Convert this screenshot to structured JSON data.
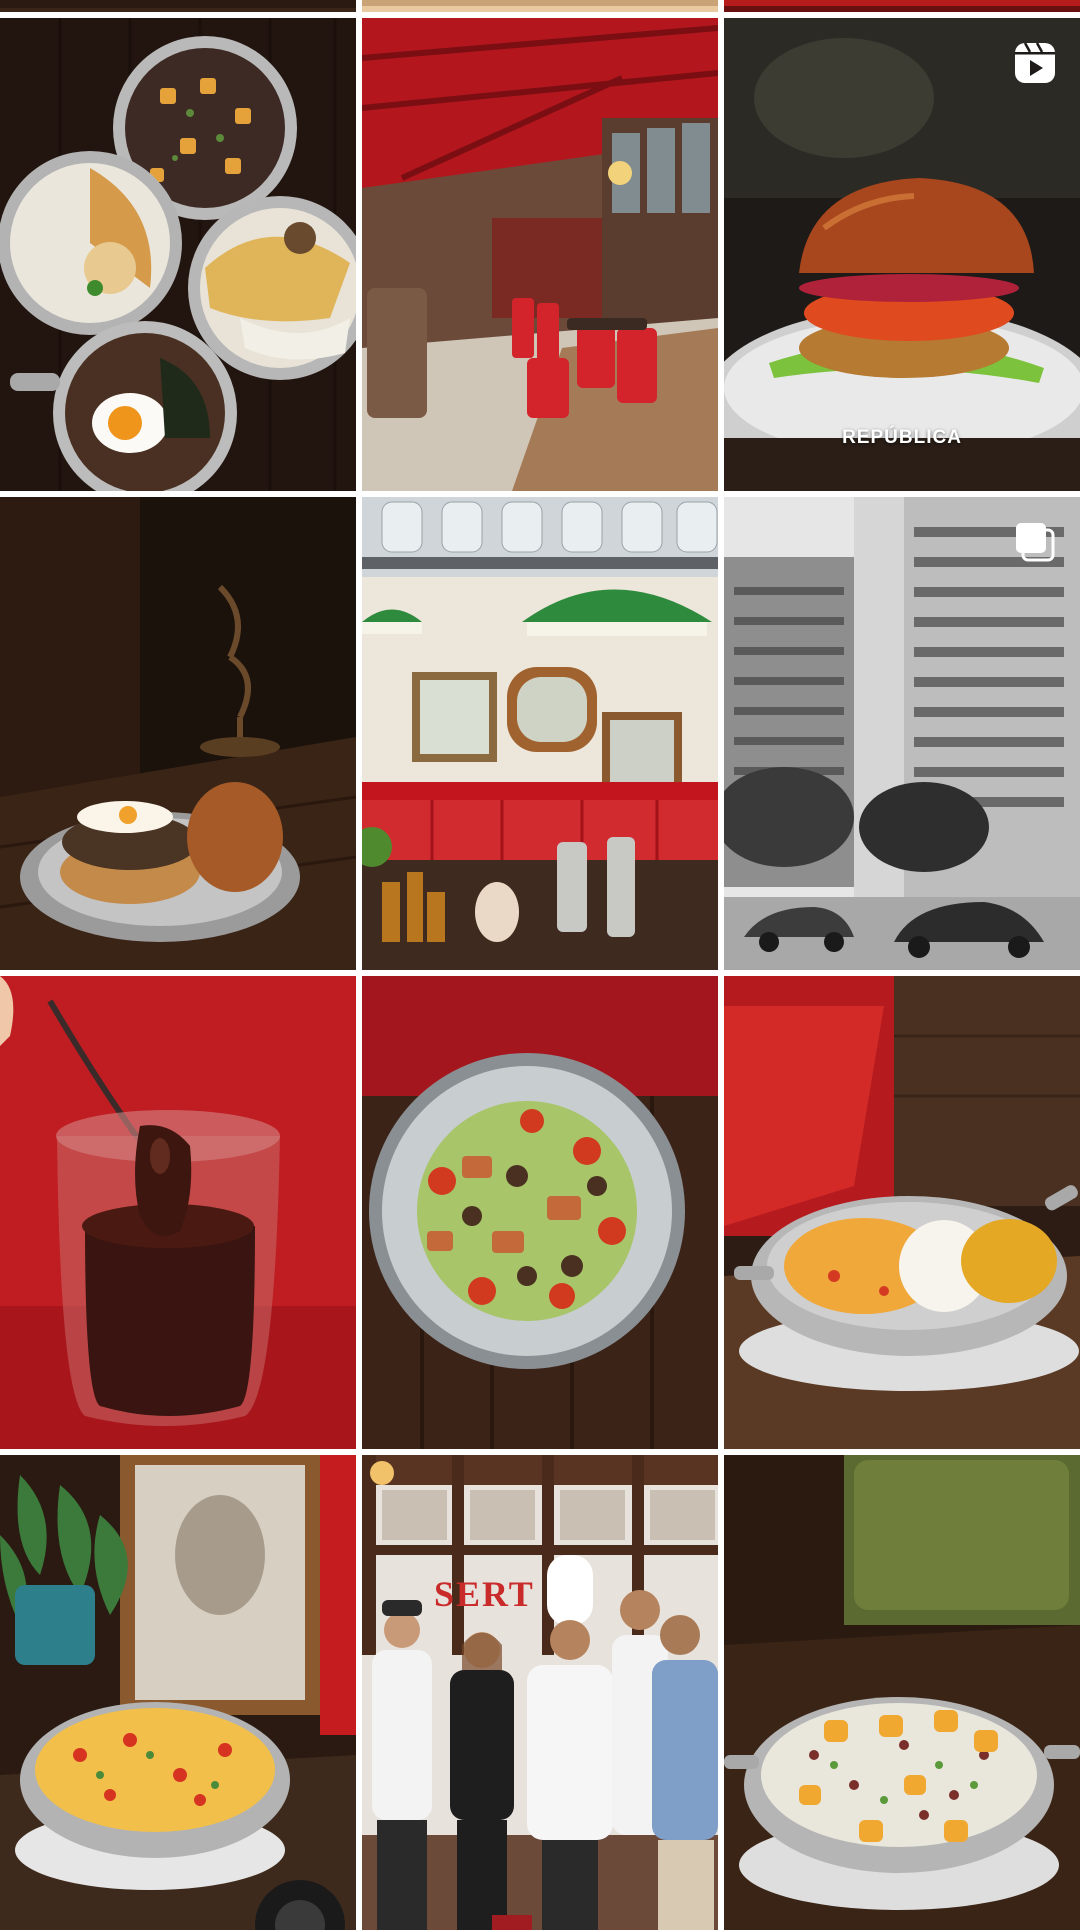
{
  "profile_grid": {
    "posts": [
      {
        "id": "top-strip-1",
        "media_type": "photo"
      },
      {
        "id": "top-strip-2",
        "media_type": "photo"
      },
      {
        "id": "top-strip-3",
        "media_type": "photo"
      },
      {
        "id": "feijoada-pans",
        "media_type": "photo"
      },
      {
        "id": "red-dining-room",
        "media_type": "photo"
      },
      {
        "id": "tomato-burger",
        "media_type": "reel",
        "caption": "REPÚBLICA"
      },
      {
        "id": "egg-burger",
        "media_type": "photo"
      },
      {
        "id": "green-lamps-bar",
        "media_type": "photo"
      },
      {
        "id": "vintage-building",
        "media_type": "carousel"
      },
      {
        "id": "chocolate-jar",
        "media_type": "photo"
      },
      {
        "id": "salad-bowl",
        "media_type": "photo"
      },
      {
        "id": "moqueca-pan",
        "media_type": "photo"
      },
      {
        "id": "risotto-pan",
        "media_type": "photo"
      },
      {
        "id": "team-photo",
        "media_type": "photo",
        "sign_text": "SERT"
      },
      {
        "id": "rice-salad-pan",
        "media_type": "photo"
      }
    ]
  },
  "icons": {
    "reel": "reel-icon",
    "carousel": "carousel-icon"
  },
  "colors": {
    "grid_gap": "#ffffff",
    "wood_dark": "#2b1a12",
    "restaurant_red": "#c4161c",
    "badge": "#ffffff"
  }
}
